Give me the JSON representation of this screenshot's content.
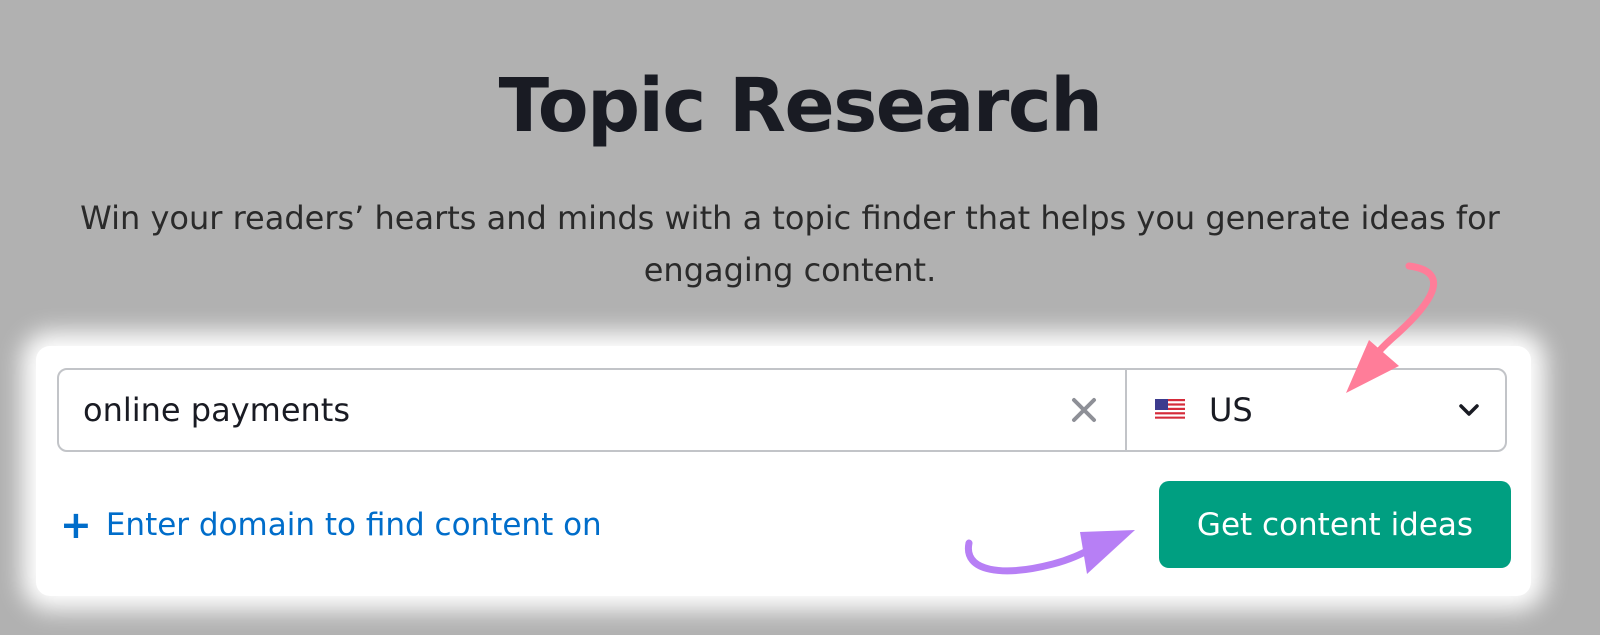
{
  "header": {
    "title": "Topic Research",
    "subtitle": "Win your readers’ hearts and minds with a topic finder that helps you generate ideas for engaging content."
  },
  "search": {
    "value": "online payments",
    "clear_icon": "close-icon"
  },
  "country": {
    "selected": "US",
    "flag_icon": "us-flag-icon",
    "dropdown_icon": "chevron-down-icon"
  },
  "actions": {
    "add_domain_label": "Enter domain to find content on",
    "add_domain_icon": "plus-icon",
    "submit_label": "Get content ideas"
  },
  "colors": {
    "backdrop": "#b1b1b1",
    "panel": "#ffffff",
    "primary_button": "#009f81",
    "link": "#006dca",
    "annotation_arrow_pink": "#ff7d99",
    "annotation_arrow_purple": "#b77ff5"
  }
}
